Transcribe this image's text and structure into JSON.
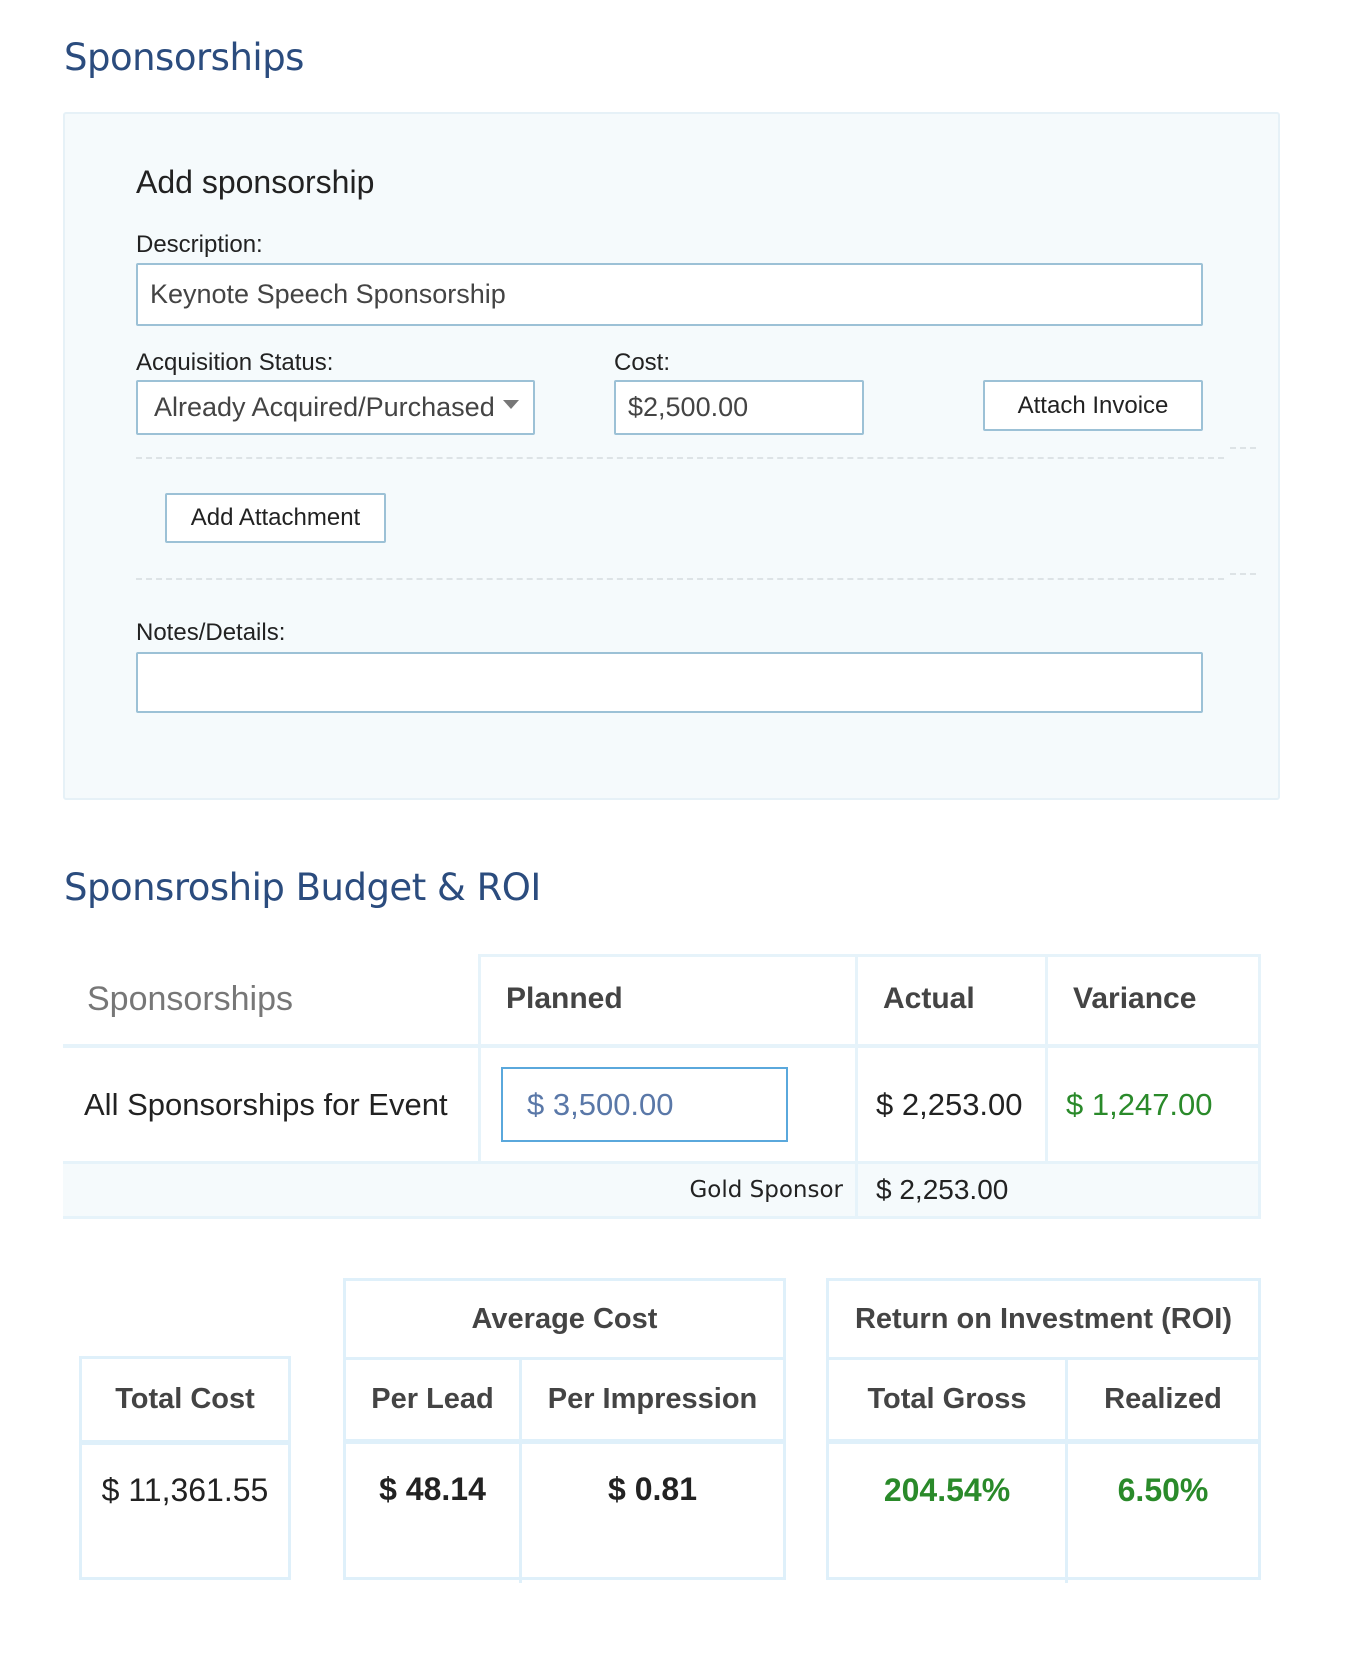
{
  "page_title": "Sponsorships",
  "form": {
    "heading": "Add sponsorship",
    "description_label": "Description:",
    "description_value": "Keynote Speech Sponsorship",
    "acquisition_label": "Acquisition Status:",
    "acquisition_value": "Already Acquired/Purchased",
    "cost_label": "Cost:",
    "cost_value": "$2,500.00",
    "attach_invoice": "Attach Invoice",
    "add_attachment": "Add Attachment",
    "notes_label": "Notes/Details:",
    "notes_value": ""
  },
  "budget": {
    "title": "Sponsroship Budget & ROI",
    "headers": {
      "name": "Sponsorships",
      "planned": "Planned",
      "actual": "Actual",
      "variance": "Variance"
    },
    "row": {
      "name": "All Sponsorships for Event",
      "planned": "$ 3,500.00",
      "actual": "$ 2,253.00",
      "variance": "$ 1,247.00"
    },
    "sub_row": {
      "name": "Gold Sponsor",
      "actual": "$ 2,253.00"
    }
  },
  "summary": {
    "total_cost_label": "Total Cost",
    "total_cost": "$ 11,361.55",
    "avg_cost_label": "Average Cost",
    "per_lead_label": "Per Lead",
    "per_lead": "$ 48.14",
    "per_impression_label": "Per Impression",
    "per_impression": "$ 0.81",
    "roi_label": "Return on Investment (ROI)",
    "total_gross_label": "Total Gross",
    "total_gross": "204.54%",
    "realized_label": "Realized",
    "realized": "6.50%"
  },
  "colors": {
    "title": "#2b4c7e",
    "positive": "#2a8a2a",
    "input_border": "#9cc1d6"
  }
}
